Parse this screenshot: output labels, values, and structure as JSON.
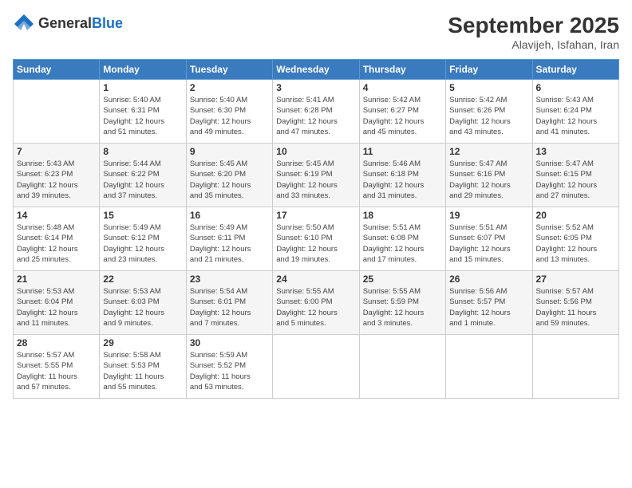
{
  "header": {
    "logo_general": "General",
    "logo_blue": "Blue",
    "month_title": "September 2025",
    "location": "Alavijeh, Isfahan, Iran"
  },
  "days_of_week": [
    "Sunday",
    "Monday",
    "Tuesday",
    "Wednesday",
    "Thursday",
    "Friday",
    "Saturday"
  ],
  "weeks": [
    [
      {
        "num": "",
        "info": ""
      },
      {
        "num": "1",
        "info": "Sunrise: 5:40 AM\nSunset: 6:31 PM\nDaylight: 12 hours\nand 51 minutes."
      },
      {
        "num": "2",
        "info": "Sunrise: 5:40 AM\nSunset: 6:30 PM\nDaylight: 12 hours\nand 49 minutes."
      },
      {
        "num": "3",
        "info": "Sunrise: 5:41 AM\nSunset: 6:28 PM\nDaylight: 12 hours\nand 47 minutes."
      },
      {
        "num": "4",
        "info": "Sunrise: 5:42 AM\nSunset: 6:27 PM\nDaylight: 12 hours\nand 45 minutes."
      },
      {
        "num": "5",
        "info": "Sunrise: 5:42 AM\nSunset: 6:26 PM\nDaylight: 12 hours\nand 43 minutes."
      },
      {
        "num": "6",
        "info": "Sunrise: 5:43 AM\nSunset: 6:24 PM\nDaylight: 12 hours\nand 41 minutes."
      }
    ],
    [
      {
        "num": "7",
        "info": "Sunrise: 5:43 AM\nSunset: 6:23 PM\nDaylight: 12 hours\nand 39 minutes."
      },
      {
        "num": "8",
        "info": "Sunrise: 5:44 AM\nSunset: 6:22 PM\nDaylight: 12 hours\nand 37 minutes."
      },
      {
        "num": "9",
        "info": "Sunrise: 5:45 AM\nSunset: 6:20 PM\nDaylight: 12 hours\nand 35 minutes."
      },
      {
        "num": "10",
        "info": "Sunrise: 5:45 AM\nSunset: 6:19 PM\nDaylight: 12 hours\nand 33 minutes."
      },
      {
        "num": "11",
        "info": "Sunrise: 5:46 AM\nSunset: 6:18 PM\nDaylight: 12 hours\nand 31 minutes."
      },
      {
        "num": "12",
        "info": "Sunrise: 5:47 AM\nSunset: 6:16 PM\nDaylight: 12 hours\nand 29 minutes."
      },
      {
        "num": "13",
        "info": "Sunrise: 5:47 AM\nSunset: 6:15 PM\nDaylight: 12 hours\nand 27 minutes."
      }
    ],
    [
      {
        "num": "14",
        "info": "Sunrise: 5:48 AM\nSunset: 6:14 PM\nDaylight: 12 hours\nand 25 minutes."
      },
      {
        "num": "15",
        "info": "Sunrise: 5:49 AM\nSunset: 6:12 PM\nDaylight: 12 hours\nand 23 minutes."
      },
      {
        "num": "16",
        "info": "Sunrise: 5:49 AM\nSunset: 6:11 PM\nDaylight: 12 hours\nand 21 minutes."
      },
      {
        "num": "17",
        "info": "Sunrise: 5:50 AM\nSunset: 6:10 PM\nDaylight: 12 hours\nand 19 minutes."
      },
      {
        "num": "18",
        "info": "Sunrise: 5:51 AM\nSunset: 6:08 PM\nDaylight: 12 hours\nand 17 minutes."
      },
      {
        "num": "19",
        "info": "Sunrise: 5:51 AM\nSunset: 6:07 PM\nDaylight: 12 hours\nand 15 minutes."
      },
      {
        "num": "20",
        "info": "Sunrise: 5:52 AM\nSunset: 6:05 PM\nDaylight: 12 hours\nand 13 minutes."
      }
    ],
    [
      {
        "num": "21",
        "info": "Sunrise: 5:53 AM\nSunset: 6:04 PM\nDaylight: 12 hours\nand 11 minutes."
      },
      {
        "num": "22",
        "info": "Sunrise: 5:53 AM\nSunset: 6:03 PM\nDaylight: 12 hours\nand 9 minutes."
      },
      {
        "num": "23",
        "info": "Sunrise: 5:54 AM\nSunset: 6:01 PM\nDaylight: 12 hours\nand 7 minutes."
      },
      {
        "num": "24",
        "info": "Sunrise: 5:55 AM\nSunset: 6:00 PM\nDaylight: 12 hours\nand 5 minutes."
      },
      {
        "num": "25",
        "info": "Sunrise: 5:55 AM\nSunset: 5:59 PM\nDaylight: 12 hours\nand 3 minutes."
      },
      {
        "num": "26",
        "info": "Sunrise: 5:56 AM\nSunset: 5:57 PM\nDaylight: 12 hours\nand 1 minute."
      },
      {
        "num": "27",
        "info": "Sunrise: 5:57 AM\nSunset: 5:56 PM\nDaylight: 11 hours\nand 59 minutes."
      }
    ],
    [
      {
        "num": "28",
        "info": "Sunrise: 5:57 AM\nSunset: 5:55 PM\nDaylight: 11 hours\nand 57 minutes."
      },
      {
        "num": "29",
        "info": "Sunrise: 5:58 AM\nSunset: 5:53 PM\nDaylight: 11 hours\nand 55 minutes."
      },
      {
        "num": "30",
        "info": "Sunrise: 5:59 AM\nSunset: 5:52 PM\nDaylight: 11 hours\nand 53 minutes."
      },
      {
        "num": "",
        "info": ""
      },
      {
        "num": "",
        "info": ""
      },
      {
        "num": "",
        "info": ""
      },
      {
        "num": "",
        "info": ""
      }
    ]
  ]
}
